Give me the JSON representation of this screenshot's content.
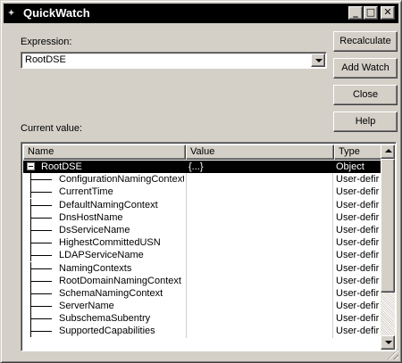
{
  "window": {
    "title": "QuickWatch",
    "icon": "watch-glasses-icon",
    "caption_buttons": {
      "minimize": "_",
      "maximize": "□",
      "close": "✕"
    }
  },
  "expression": {
    "label": "Expression:",
    "value": "RootDSE"
  },
  "current_value": {
    "label": "Current value:"
  },
  "buttons": {
    "recalculate": "Recalculate",
    "add_watch": "Add Watch",
    "close": "Close",
    "help": "Help"
  },
  "list": {
    "columns": [
      "Name",
      "Value",
      "Type"
    ],
    "root": {
      "name": "RootDSE",
      "value": "{...}",
      "type": "Object"
    },
    "rows": [
      {
        "name": "ConfigurationNamingContext",
        "value": "",
        "type": "User-defir"
      },
      {
        "name": "CurrentTime",
        "value": "",
        "type": "User-defir"
      },
      {
        "name": "DefaultNamingContext",
        "value": "",
        "type": "User-defir"
      },
      {
        "name": "DnsHostName",
        "value": "",
        "type": "User-defir"
      },
      {
        "name": "DsServiceName",
        "value": "",
        "type": "User-defir"
      },
      {
        "name": "HighestCommittedUSN",
        "value": "",
        "type": "User-defir"
      },
      {
        "name": "LDAPServiceName",
        "value": "",
        "type": "User-defir"
      },
      {
        "name": "NamingContexts",
        "value": "",
        "type": "User-defir"
      },
      {
        "name": "RootDomainNamingContext",
        "value": "",
        "type": "User-defir"
      },
      {
        "name": "SchemaNamingContext",
        "value": "",
        "type": "User-defir"
      },
      {
        "name": "ServerName",
        "value": "",
        "type": "User-defir"
      },
      {
        "name": "SubschemaSubentry",
        "value": "",
        "type": "User-defir"
      },
      {
        "name": "SupportedCapabilities",
        "value": "",
        "type": "User-defir"
      }
    ]
  },
  "colors": {
    "face": "#d4d0c8",
    "titlebar": "#000000",
    "selection": "#000000",
    "selection_text": "#ffffff"
  }
}
